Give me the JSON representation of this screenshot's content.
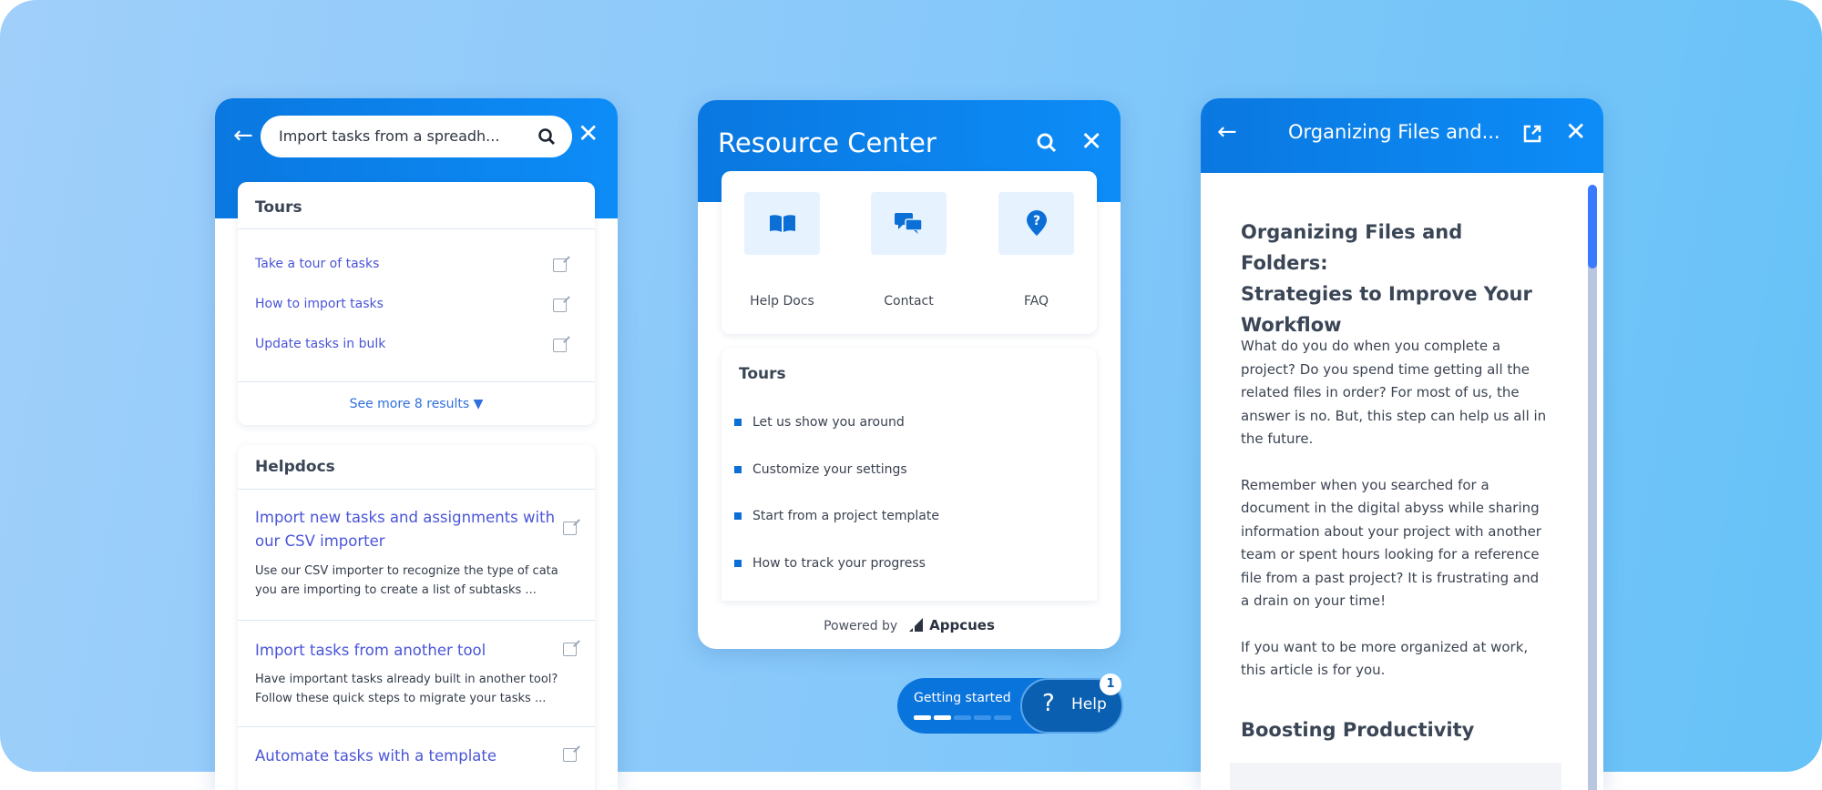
{
  "search_panel": {
    "search_value": "Import tasks from a spreadh...",
    "tours": {
      "heading": "Tours",
      "items": [
        "Take a tour of tasks",
        "How to import tasks",
        "Update tasks in bulk"
      ],
      "see_more": "See more 8 results"
    },
    "helpdocs": {
      "heading": "Helpdocs",
      "items": [
        {
          "title_line1": "Import new tasks and assignments with",
          "title_line2": "our CSV importer",
          "desc_line1": "Use our CSV importer to recognize the type of cata",
          "desc_line2": "you are importing to create a list of subtasks ..."
        },
        {
          "title_line1": "Import tasks from another tool",
          "desc_line1": "Have important tasks already built in another tool?",
          "desc_line2": "Follow these quick steps to migrate your tasks ..."
        },
        {
          "title_line1": "Automate tasks with a template"
        }
      ]
    }
  },
  "resource_center": {
    "title": "Resource Center",
    "tiles": [
      {
        "label": "Help Docs",
        "icon": "book-icon"
      },
      {
        "label": "Contact",
        "icon": "chat-icon"
      },
      {
        "label": "FAQ",
        "icon": "question-pin-icon"
      }
    ],
    "tours": {
      "heading": "Tours",
      "items": [
        "Let us show you around",
        "Customize your settings",
        "Start from a project template",
        "How to track your progress"
      ]
    },
    "powered_by": "Powered by",
    "brand": "Appcues"
  },
  "launcher": {
    "getting_started": "Getting started",
    "progress_steps": 5,
    "progress_done": 2,
    "help": "Help",
    "badge": "1"
  },
  "article_panel": {
    "header_title": "Organizing Files and...",
    "heading_lines": [
      "Organizing Files and Folders:",
      "Strategies to Improve Your",
      "Workflow"
    ],
    "paragraphs": [
      [
        "What do you do when you complete a",
        "project? Do you spend time getting all the",
        "related files in order? For most of us, the",
        "answer is no. But, this step can help us all in",
        "the future."
      ],
      [
        "Remember when you searched for a",
        "document in the digital abyss while sharing",
        "information about your project with another",
        "team or spent hours looking for a reference",
        "file from a past project? It is frustrating and",
        "a drain on your time!"
      ],
      [
        "If you want to be more organized at work,",
        "this article is for you."
      ]
    ],
    "subheading": "Boosting Productivity",
    "scroll_position": 0.0
  },
  "colors": {
    "primary": "#0d84f0",
    "link": "#4a55d8",
    "scroll_thumb": "#3a7afe",
    "launcher_dark": "#0a5fb0"
  }
}
